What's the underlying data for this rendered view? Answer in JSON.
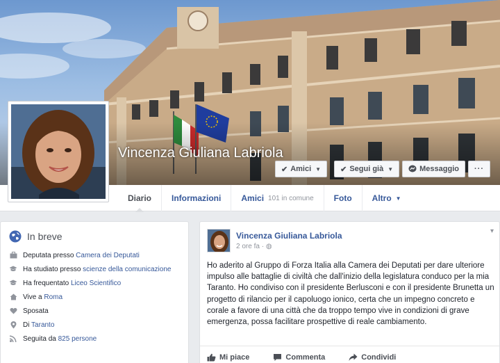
{
  "profile": {
    "name": "Vincenza Giuliana Labriola"
  },
  "actions": {
    "friends": "Amici",
    "following": "Segui già",
    "message": "Messaggio",
    "more": "···"
  },
  "tabs": [
    {
      "label": "Diario"
    },
    {
      "label": "Informazioni"
    },
    {
      "label": "Amici",
      "sub": "101 in comune"
    },
    {
      "label": "Foto"
    },
    {
      "label": "Altro"
    }
  ],
  "intro": {
    "title": "In breve",
    "items": [
      {
        "icon": "briefcase-icon",
        "prefix": "Deputata presso ",
        "link": "Camera dei Deputati"
      },
      {
        "icon": "graduation-cap-icon",
        "prefix": "Ha studiato presso ",
        "link": "scienze della comunicazione"
      },
      {
        "icon": "graduation-cap-icon",
        "prefix": "Ha frequentato ",
        "link": "Liceo Scientifico"
      },
      {
        "icon": "house-icon",
        "prefix": "Vive a ",
        "link": "Roma"
      },
      {
        "icon": "heart-icon",
        "prefix": "Sposata",
        "link": ""
      },
      {
        "icon": "location-pin-icon",
        "prefix": "Di ",
        "link": "Taranto"
      },
      {
        "icon": "rss-icon",
        "prefix": "Seguita da ",
        "link": "825 persone"
      }
    ]
  },
  "post": {
    "author": "Vincenza Giuliana Labriola",
    "time": "2 ore fa ·",
    "text": "Ho aderito al Gruppo di Forza Italia alla Camera dei Deputati per dare ulteriore impulso alle battaglie di civiltà che dall'inizio della legislatura conduco per la mia Taranto. Ho condiviso con il presidente Berlusconi e con il presidente Brunetta un progetto di rilancio per il capoluogo ionico, certa che un impegno concreto e corale a favore di una città che da troppo tempo vive in condizioni di grave emergenza, possa facilitare prospettive di reale cambiamento.",
    "like": "Mi piace",
    "comment": "Commenta",
    "share": "Condividi"
  },
  "colors": {
    "link": "#365899",
    "background": "#e9ebee"
  }
}
